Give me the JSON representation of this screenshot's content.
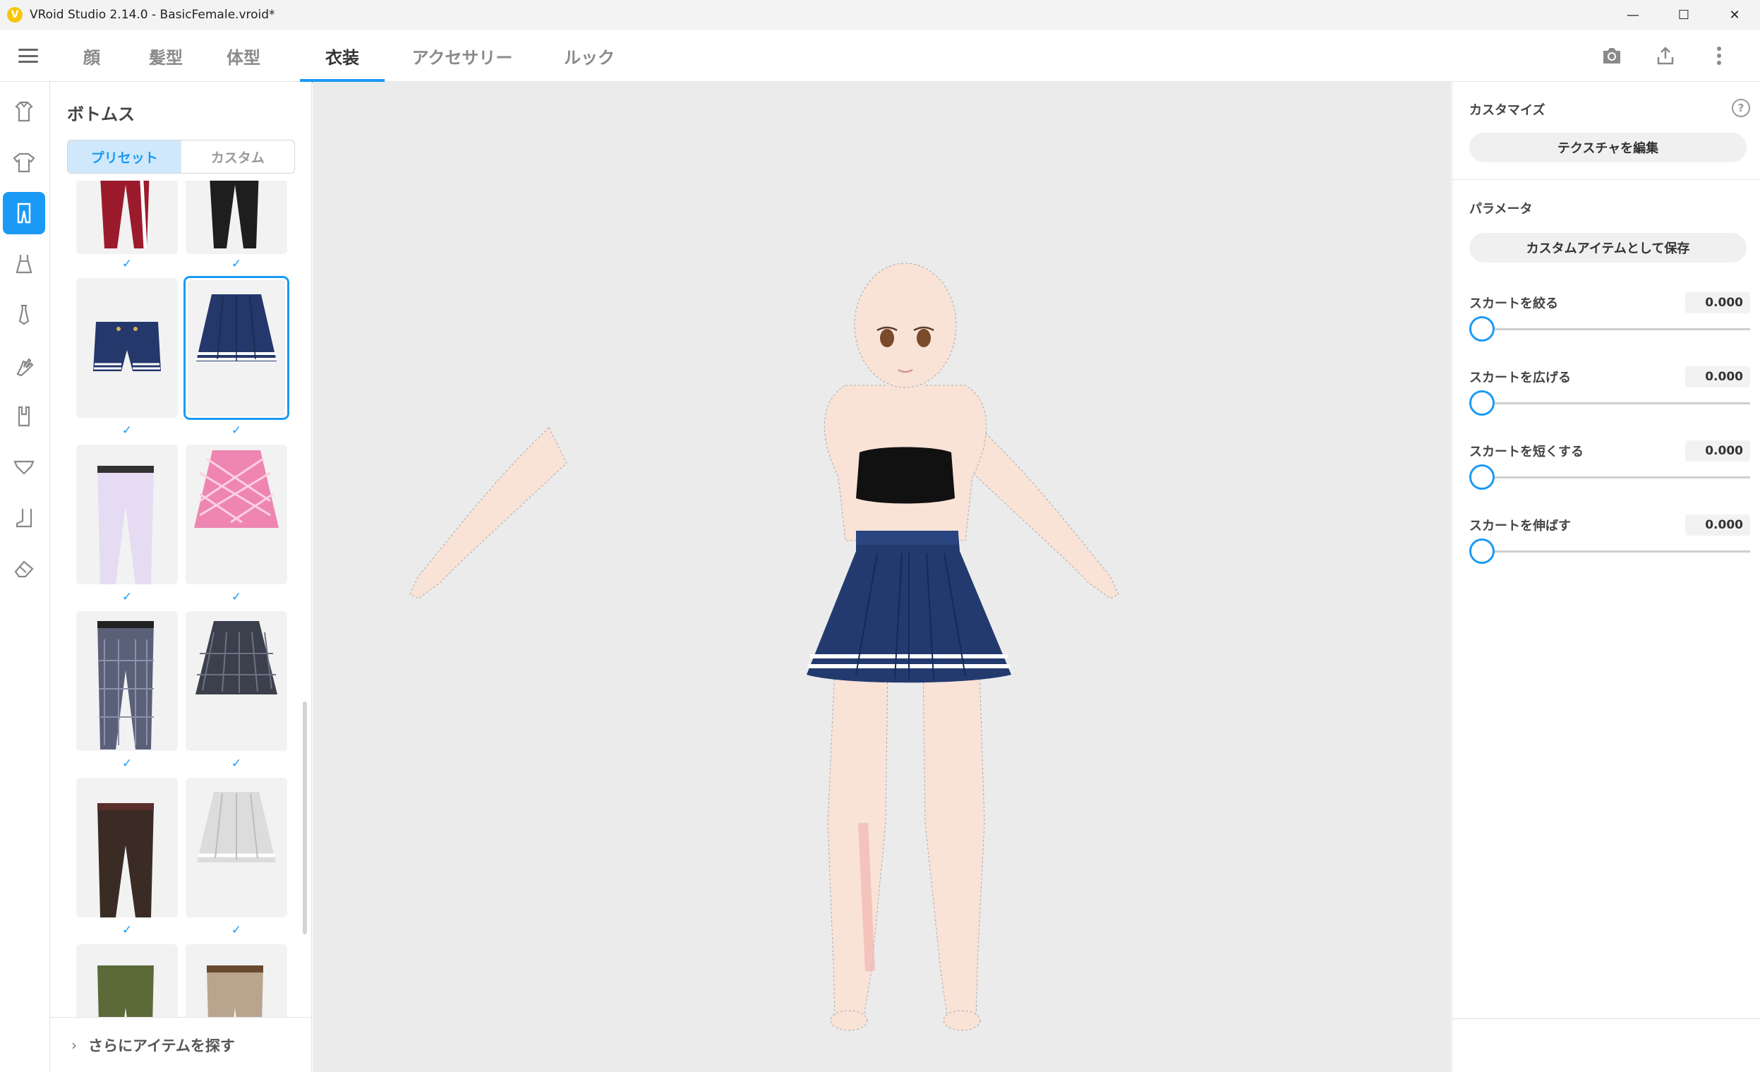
{
  "window": {
    "title": "VRoid Studio 2.14.0 - BasicFemale.vroid*",
    "logo_glyph": "V",
    "controls": {
      "minimize": "—",
      "maximize": "☐",
      "close": "✕"
    }
  },
  "nav": {
    "tabs": [
      {
        "label": "顔"
      },
      {
        "label": "髪型"
      },
      {
        "label": "体型"
      },
      {
        "label": "衣装"
      },
      {
        "label": "アクセサリー"
      },
      {
        "label": "ルック"
      }
    ],
    "active_tab": "衣装",
    "actions": [
      "camera-icon",
      "export-icon",
      "more-icon"
    ]
  },
  "rail": {
    "items": [
      "outfit-set-icon",
      "tops-icon",
      "bottoms-icon",
      "onepiece-icon",
      "tie-icon",
      "glove-icon",
      "legwear-icon",
      "underwear-icon",
      "shoes-icon",
      "eraser-icon"
    ],
    "active_index": 2
  },
  "panel": {
    "title": "ボトムス",
    "segments": {
      "preset": "プリセット",
      "custom": "カスタム"
    },
    "check_glyph": "✓",
    "items": [
      {
        "name": "red-tracksuit-pants",
        "checked": true
      },
      {
        "name": "black-jeans",
        "checked": true
      },
      {
        "name": "navy-shorts",
        "checked": true
      },
      {
        "name": "navy-pleated-skirt",
        "checked": true,
        "selected": true
      },
      {
        "name": "white-pants",
        "checked": true
      },
      {
        "name": "pink-plaid-skirt",
        "checked": true
      },
      {
        "name": "plaid-trousers",
        "checked": true
      },
      {
        "name": "gray-plaid-skirt",
        "checked": true
      },
      {
        "name": "brown-trousers",
        "checked": true
      },
      {
        "name": "white-pleated-skirt",
        "checked": true
      },
      {
        "name": "olive-pants",
        "checked": false
      },
      {
        "name": "beige-pants",
        "checked": false
      }
    ],
    "footer": {
      "chevron": "›",
      "label": "さらにアイテムを探す"
    }
  },
  "right": {
    "customize_title": "カスタマイズ",
    "help_glyph": "?",
    "edit_texture": "テクスチャを編集",
    "params_title": "パラメータ",
    "save_custom": "カスタムアイテムとして保存",
    "params": [
      {
        "label": "スカートを絞る",
        "value": "0.000"
      },
      {
        "label": "スカートを広げる",
        "value": "0.000"
      },
      {
        "label": "スカートを短くする",
        "value": "0.000"
      },
      {
        "label": "スカートを伸ばす",
        "value": "0.000"
      }
    ]
  },
  "colors": {
    "accent": "#1b9af5",
    "skin": "#f9e2d6",
    "skirt": "#223a6e",
    "top": "#111111"
  }
}
